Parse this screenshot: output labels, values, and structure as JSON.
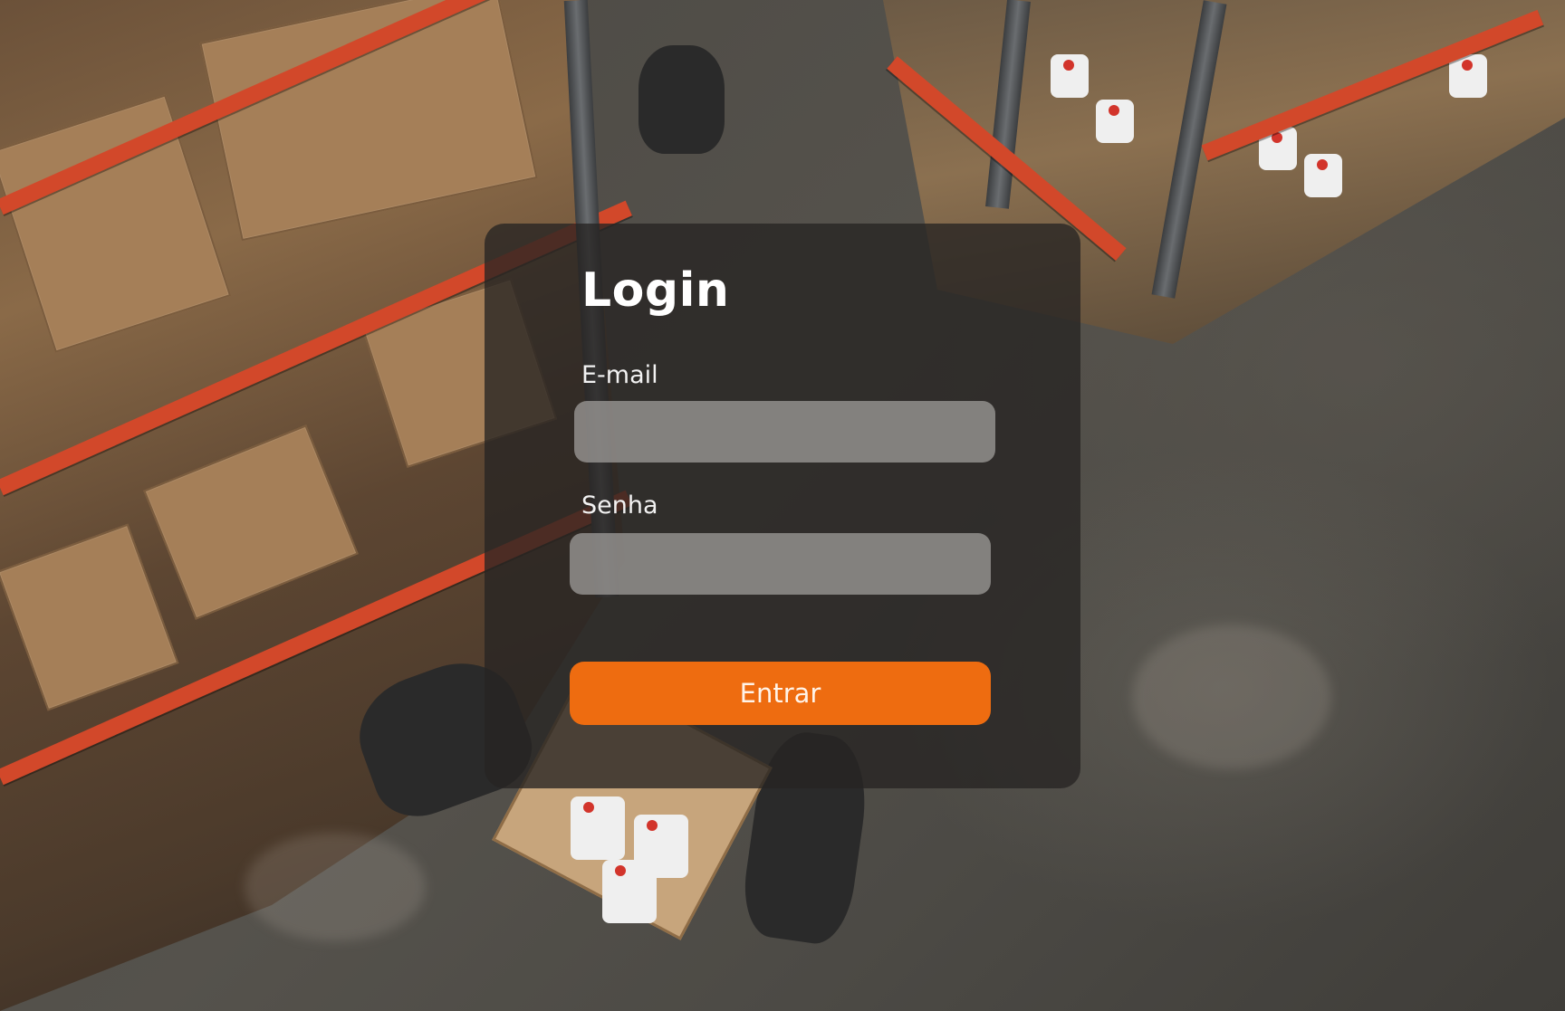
{
  "login": {
    "title": "Login",
    "email": {
      "label": "E-mail",
      "value": "",
      "placeholder": ""
    },
    "password": {
      "label": "Senha",
      "value": "",
      "placeholder": ""
    },
    "submit_label": "Entrar"
  },
  "colors": {
    "accent": "#ee6c10",
    "card_background": "#262422",
    "input_background": "#969491"
  }
}
